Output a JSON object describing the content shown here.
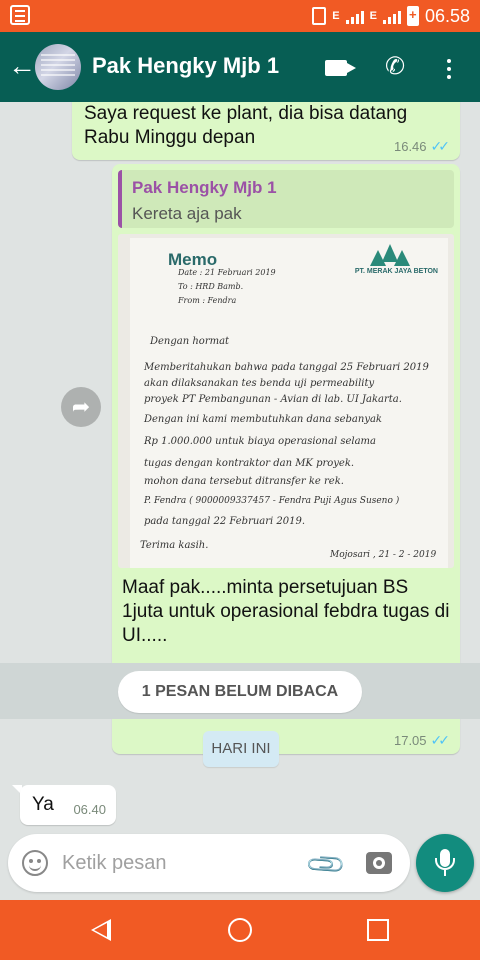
{
  "status_bar": {
    "network_1": "E",
    "network_2": "E",
    "time": "06.58",
    "icons": [
      "notification-icon",
      "vibrate-icon",
      "signal-icon",
      "signal-icon",
      "battery-icon"
    ]
  },
  "header": {
    "back_icon": "arrow-back-icon",
    "contact_name": "Pak Hengky Mjb 1",
    "icons": [
      "video-call-icon",
      "voice-call-icon",
      "more-vert-icon"
    ]
  },
  "messages": [
    {
      "direction": "out",
      "text": "Saya request ke plant, dia bisa datang Rabu Minggu depan",
      "time": "16.46",
      "status": "read"
    },
    {
      "direction": "out",
      "quote": {
        "author": "Pak Hengky Mjb 1",
        "text": "Kereta aja pak"
      },
      "image": {
        "kind": "photo of handwritten memo",
        "memo_title": "Memo",
        "company": "PT. MERAK JAYA BETON",
        "handwriting": [
          "Date : 21 Februari 2019",
          "To : HRD Bamb.",
          "From : Fendra",
          "Dengan hormat",
          "Memberitahukan bahwa pada tanggal 25 Februari 2019",
          "akan dilaksanakan tes benda uji permeability",
          "proyek PT Pembangunan - Avian di lab. UI Jakarta.",
          "Dengan ini kami membutuhkan dana sebanyak",
          "Rp 1.000.000 untuk biaya operasional selama",
          "tugas dengan kontraktor dan MK proyek.",
          "mohon dana tersebut ditransfer ke rek.",
          "P. Fendra ( 9000009337457 - Fendra Puji Agus Suseno )",
          "pada tanggal 22 Februari 2019.",
          "Terima kasih.",
          "Mojosari , 21 - 2 - 2019"
        ]
      },
      "caption": "Maaf pak.....minta persetujuan BS 1juta untuk operasional febdra tugas di UI.....",
      "time": "17.05",
      "status": "read"
    }
  ],
  "forward_icon": "forward-icon",
  "unread_banner": "1 PESAN BELUM DIBACA",
  "date_divider": "HARI INI",
  "incoming": {
    "text": "Ya",
    "time": "06.40"
  },
  "input": {
    "placeholder": "Ketik pesan",
    "value": "",
    "icons": [
      "emoji-icon",
      "attach-icon",
      "camera-icon",
      "mic-icon"
    ]
  },
  "nav_bar": {
    "icons": [
      "nav-back-icon",
      "nav-home-icon",
      "nav-recent-icon"
    ]
  },
  "colors": {
    "status_bar": "#f15a24",
    "header": "#075e54",
    "bubble_out": "#dcf8c6",
    "bubble_in": "#ffffff",
    "accent": "#128c7e",
    "read_ticks": "#4fc3f7",
    "quote_author": "#9b51a6"
  }
}
